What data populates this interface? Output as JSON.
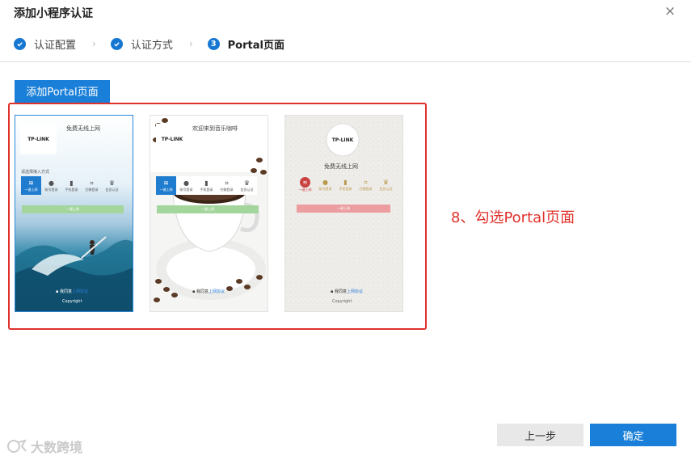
{
  "dialog": {
    "title": "添加小程序认证",
    "close": "×"
  },
  "steps": [
    {
      "label": "认证配置",
      "state": "done"
    },
    {
      "label": "认证方式",
      "state": "done"
    },
    {
      "label": "Portal页面",
      "state": "current",
      "number": "3"
    }
  ],
  "step_separator": "›",
  "add_portal_label": "添加Portal页面",
  "templates": [
    {
      "selected": true,
      "logo": "TP-LINK",
      "title": "免费无线上网",
      "method_label": "请选择接入方式",
      "methods": [
        "一键上网",
        "账号登录",
        "手机登录",
        "扫微登录",
        "会员认证"
      ],
      "button": "一键上网",
      "agree": "我同意",
      "agree_link": "上网协议",
      "copyright": "Copyright"
    },
    {
      "selected": false,
      "logo": "TP-LINK",
      "title": "欢迎来到音乐咖啡",
      "methods": [
        "一键上网",
        "账号登录",
        "手机登录",
        "扫微登录",
        "会员认证"
      ],
      "button": "一键上网",
      "agree": "我同意",
      "agree_link": "上网协议"
    },
    {
      "selected": false,
      "logo": "TP-LINK",
      "title": "免费无线上网",
      "methods": [
        "一键上网",
        "账号登录",
        "手机登录",
        "扫微登录",
        "会员认证"
      ],
      "button": "一键上网",
      "agree": "我同意",
      "agree_link": "上网协议",
      "copyright": "Copyright"
    }
  ],
  "annotation": "8、勾选Portal页面",
  "footer": {
    "prev": "上一步",
    "ok": "确定"
  },
  "watermark": "大数跨境",
  "colors": {
    "primary": "#1a7fd8",
    "highlight": "#e0302a",
    "card2_accent": "#1f7ccf",
    "card3_accent": "#c94242",
    "card1_button": "#a3d59c",
    "card3_button": "#ec9da0"
  }
}
